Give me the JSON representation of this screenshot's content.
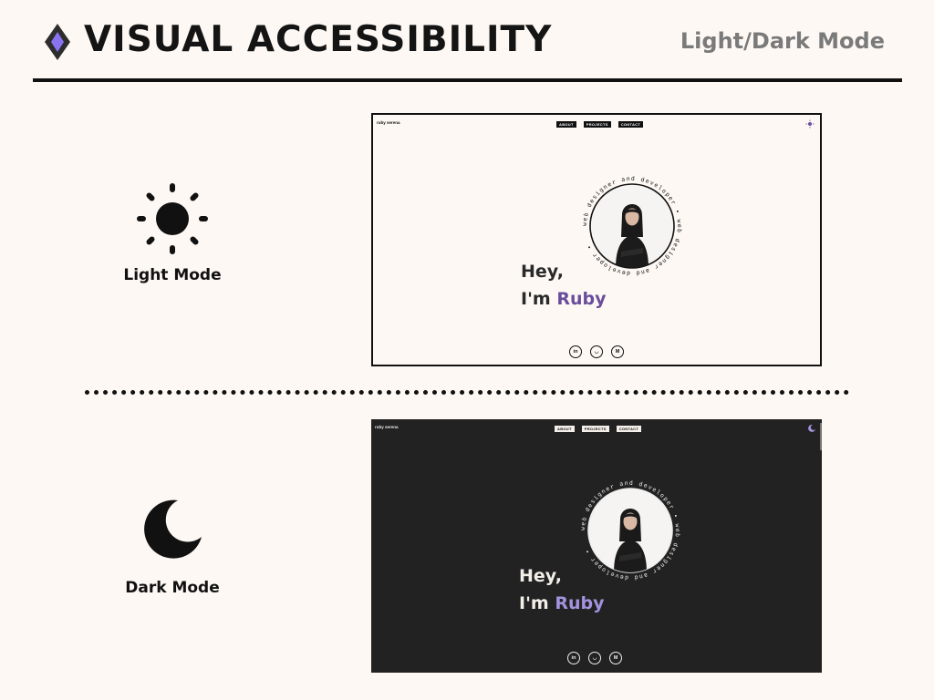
{
  "header": {
    "title": "VISUAL ACCESSIBILITY",
    "subtitle": "Light/Dark Mode",
    "logo_icon": "diamond-logo-icon"
  },
  "light_section": {
    "label": "Light Mode",
    "icon": "sun-icon"
  },
  "dark_section": {
    "label": "Dark Mode",
    "icon": "moon-icon"
  },
  "site": {
    "brand": "ruby serena",
    "nav": [
      "ABOUT",
      "PROJECTS",
      "CONTACT"
    ],
    "greeting": "Hey,",
    "intro_prefix": "I'm ",
    "name": "Ruby",
    "circle_text": "web designer and developer • web designer and developer •",
    "socials": [
      {
        "label": "in",
        "icon": "linkedin-icon"
      },
      {
        "label": "◡",
        "icon": "github-icon"
      },
      {
        "label": "M",
        "icon": "medium-icon"
      }
    ]
  },
  "colors": {
    "background": "#fdf8f3",
    "ink": "#111111",
    "accent_light": "#6a4d9c",
    "accent_dark": "#a393df",
    "dark_bg": "#232222",
    "logo_purple": "#8a73f0"
  }
}
